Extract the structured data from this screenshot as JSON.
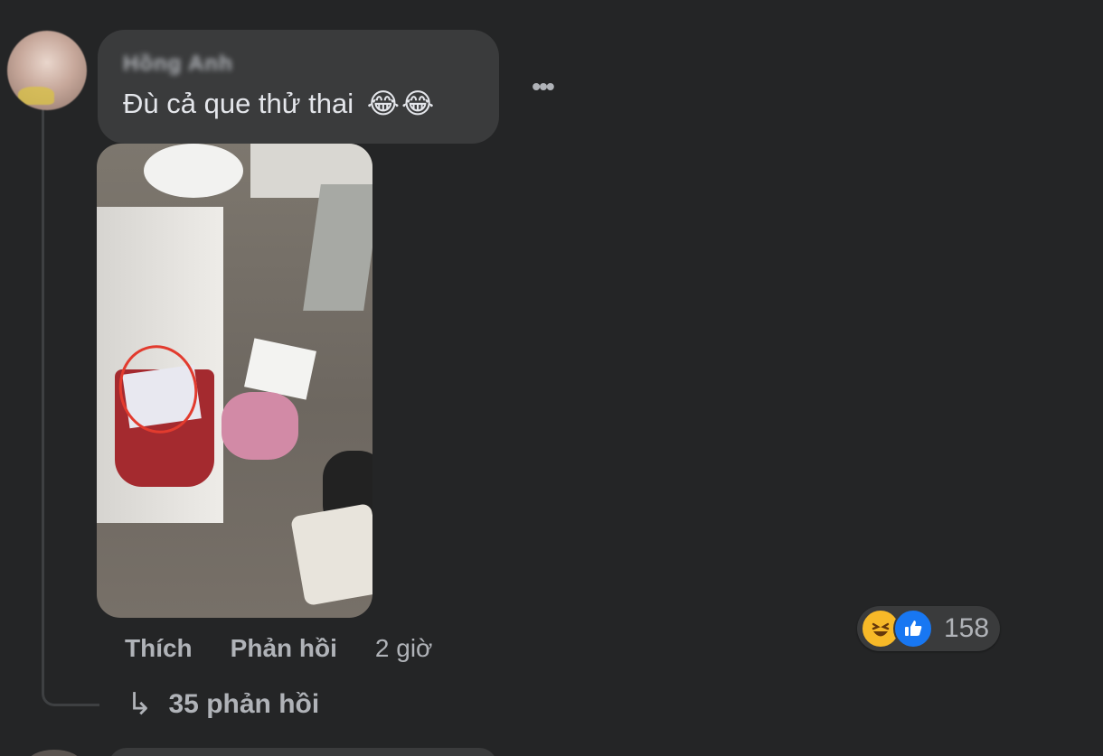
{
  "comment": {
    "author": "Hồng Anh",
    "text": "Đù cả que thử thai",
    "emojis": [
      "😂",
      "😂"
    ],
    "more_label": "•••",
    "actions": {
      "like_label": "Thích",
      "reply_label": "Phản hồi",
      "timestamp": "2 giờ"
    },
    "reactions": {
      "types": [
        "haha-icon",
        "like-icon"
      ],
      "count": "158"
    },
    "replies": {
      "arrow": "↳",
      "label": "35 phản hồi"
    }
  },
  "colors": {
    "background": "#242526",
    "bubble": "#3a3b3c",
    "primary_text": "#e4e6eb",
    "secondary_text": "#b0b3b8",
    "like_blue": "#1877f2",
    "haha_yellow": "#f7b928",
    "annotation_red": "#e23b2e"
  }
}
